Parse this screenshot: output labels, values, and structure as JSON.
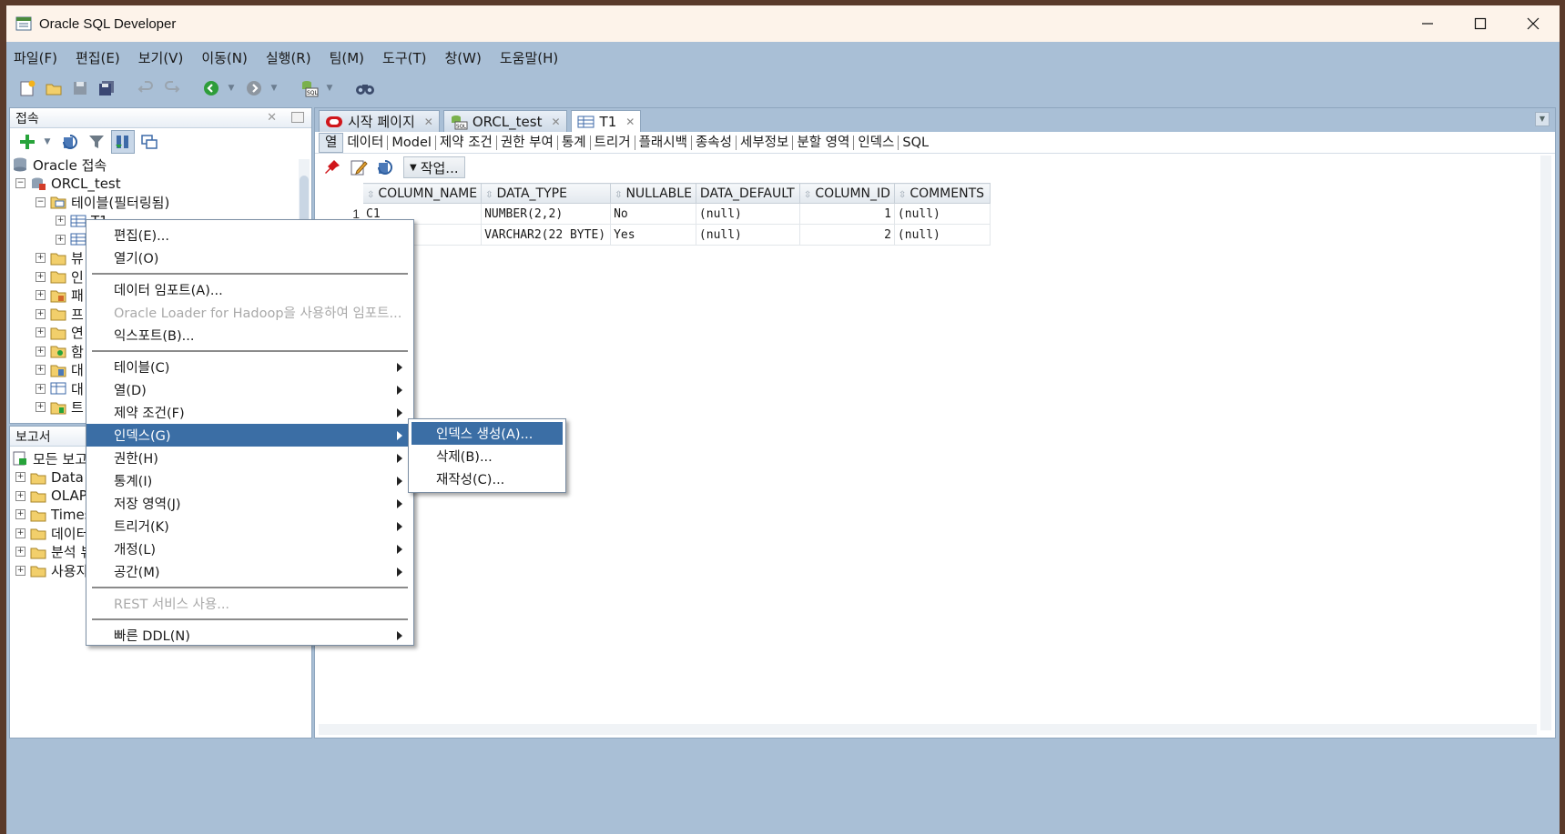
{
  "window": {
    "title": "Oracle SQL Developer"
  },
  "menubar": [
    "파일(F)",
    "편집(E)",
    "보기(V)",
    "이동(N)",
    "실행(R)",
    "팀(M)",
    "도구(T)",
    "창(W)",
    "도움말(H)"
  ],
  "connections_panel": {
    "title": "접속",
    "tree": [
      {
        "label": "Oracle 접속",
        "level": 0
      },
      {
        "label": "ORCL_test",
        "level": 1
      },
      {
        "label": "테이블(필터링됨)",
        "level": 2
      },
      {
        "label": "T1",
        "level": 3
      },
      {
        "label": "",
        "level": 3
      },
      {
        "label": "뷰",
        "level": 2
      },
      {
        "label": "인",
        "level": 2
      },
      {
        "label": "패",
        "level": 2
      },
      {
        "label": "프",
        "level": 2
      },
      {
        "label": "연",
        "level": 2
      },
      {
        "label": "함",
        "level": 2
      },
      {
        "label": "대",
        "level": 2
      },
      {
        "label": "대",
        "level": 2
      },
      {
        "label": "트",
        "level": 2
      }
    ]
  },
  "reports_panel": {
    "title": "보고서",
    "tree": [
      {
        "label": "모든 보고",
        "level": 0
      },
      {
        "label": "Data M",
        "level": 1
      },
      {
        "label": "OLAP",
        "level": 1
      },
      {
        "label": "Times",
        "level": 1
      },
      {
        "label": "데이터",
        "level": 1
      },
      {
        "label": "분석 뷰",
        "level": 1
      },
      {
        "label": "사용자",
        "level": 1
      }
    ]
  },
  "doc_tabs": [
    {
      "label": "시작 페이지",
      "active": false
    },
    {
      "label": "ORCL_test",
      "active": false
    },
    {
      "label": "T1",
      "active": true
    }
  ],
  "sub_tabs": [
    "열",
    "데이터",
    "Model",
    "제약 조건",
    "권한 부여",
    "통계",
    "트리거",
    "플래시백",
    "종속성",
    "세부정보",
    "분할 영역",
    "인덱스",
    "SQL"
  ],
  "grid_tools": {
    "action_label": "작업..."
  },
  "columns_table": {
    "headers": [
      "COLUMN_NAME",
      "DATA_TYPE",
      "NULLABLE",
      "DATA_DEFAULT",
      "COLUMN_ID",
      "COMMENTS"
    ],
    "rows": [
      {
        "rownum": "1",
        "cells": [
          "C1",
          "NUMBER(2,2)",
          "No",
          "(null)",
          "1",
          "(null)"
        ]
      },
      {
        "rownum": "",
        "cells": [
          "",
          "VARCHAR2(22 BYTE)",
          "Yes",
          "(null)",
          "2",
          "(null)"
        ]
      }
    ]
  },
  "context_menu": {
    "items": [
      {
        "label": "편집(E)...",
        "disabled": false,
        "submenu": false
      },
      {
        "label": "열기(O)",
        "disabled": false,
        "submenu": false
      },
      {
        "sep": true
      },
      {
        "label": "데이터 임포트(A)...",
        "disabled": false,
        "submenu": false
      },
      {
        "label": "Oracle Loader for Hadoop을 사용하여 임포트...",
        "disabled": true,
        "submenu": false
      },
      {
        "label": "익스포트(B)...",
        "disabled": false,
        "submenu": false
      },
      {
        "sep": true
      },
      {
        "label": "테이블(C)",
        "disabled": false,
        "submenu": true
      },
      {
        "label": "열(D)",
        "disabled": false,
        "submenu": true
      },
      {
        "label": "제약 조건(F)",
        "disabled": false,
        "submenu": true
      },
      {
        "label": "인덱스(G)",
        "disabled": false,
        "submenu": true,
        "highlighted": true
      },
      {
        "label": "권한(H)",
        "disabled": false,
        "submenu": true
      },
      {
        "label": "통계(I)",
        "disabled": false,
        "submenu": true
      },
      {
        "label": "저장 영역(J)",
        "disabled": false,
        "submenu": true
      },
      {
        "label": "트리거(K)",
        "disabled": false,
        "submenu": true
      },
      {
        "label": "개정(L)",
        "disabled": false,
        "submenu": true
      },
      {
        "label": "공간(M)",
        "disabled": false,
        "submenu": true
      },
      {
        "sep": true
      },
      {
        "label": "REST 서비스 사용...",
        "disabled": true,
        "submenu": false
      },
      {
        "sep": true
      },
      {
        "label": "빠른 DDL(N)",
        "disabled": false,
        "submenu": true
      }
    ]
  },
  "index_submenu": {
    "items": [
      {
        "label": "인덱스 생성(A)...",
        "highlighted": true
      },
      {
        "label": "삭제(B)...",
        "highlighted": false
      },
      {
        "label": "재작성(C)...",
        "highlighted": false
      }
    ]
  },
  "colors": {
    "accent": "#3b6ea5",
    "frame": "#a9bfd6",
    "titlebar": "#fdf3ea"
  }
}
